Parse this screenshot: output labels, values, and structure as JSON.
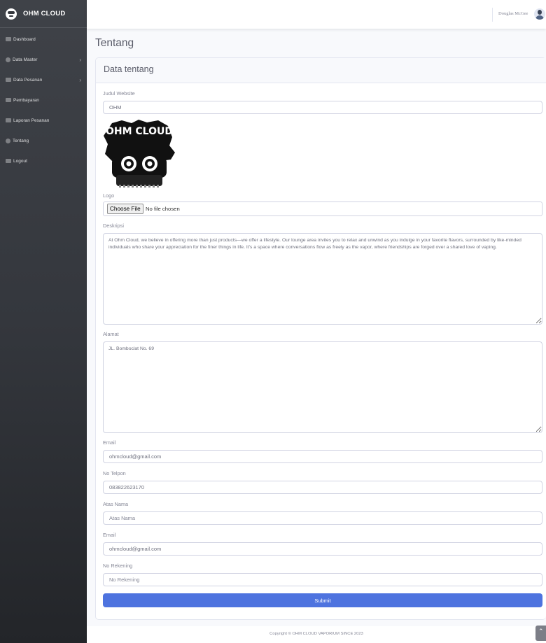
{
  "brand": {
    "name": "OHM CLOUD"
  },
  "sidebar": {
    "items": [
      {
        "label": "Dashboard"
      },
      {
        "label": "Data Master"
      },
      {
        "label": "Data Pesanan"
      },
      {
        "label": "Pembayaran"
      },
      {
        "label": "Laporan Pesanan"
      },
      {
        "label": "Tentang"
      },
      {
        "label": "Logout"
      }
    ]
  },
  "topbar": {
    "user_name": "Douglas McGee"
  },
  "page": {
    "title": "Tentang"
  },
  "card": {
    "title": "Data tentang"
  },
  "form": {
    "judul_label": "Judul Website",
    "judul_value": "OHM",
    "logo_label": "Logo",
    "logo_image_text": "OHM CLOUD",
    "file_button": "Choose File",
    "file_status": "No file chosen",
    "deskripsi_label": "Deskripsi",
    "deskripsi_value": "At Ohm Cloud, we believe in offering more than just products—we offer a lifestyle. Our lounge area invites you to relax and unwind as you indulge in your favorite flavors, surrounded by like-minded individuals who share your appreciation for the finer things in life. It's a space where conversations flow as freely as the vapor, where friendships are forged over a shared love of vaping.",
    "alamat_label": "Alamat",
    "alamat_value": "JL. Bomboclat No. 69",
    "email_label": "Email",
    "email_value": "ohmcloud@gmail.com",
    "telpon_label": "No Telpon",
    "telpon_value": "083822623170",
    "atas_nama_label": "Atas Nama",
    "atas_nama_placeholder": "Atas Nama",
    "email2_label": "Email",
    "email2_value": "ohmcloud@gmail.com",
    "rekening_label": "No Rekening",
    "rekening_placeholder": "No Rekening",
    "submit_label": "Submit"
  },
  "footer": {
    "text": "Copyright © OHM CLOUD VAPORIUM SINCE 2023"
  },
  "colors": {
    "primary": "#4e73df",
    "sidebar_top": "#3f4248",
    "sidebar_bottom": "#232529",
    "page_bg": "#f8f9fc"
  },
  "icons": [
    "dashboard-icon",
    "gear-icon",
    "cart-icon",
    "credit-card-icon",
    "report-icon",
    "info-icon",
    "logout-icon",
    "chevron-right-icon",
    "chevron-up-icon"
  ]
}
